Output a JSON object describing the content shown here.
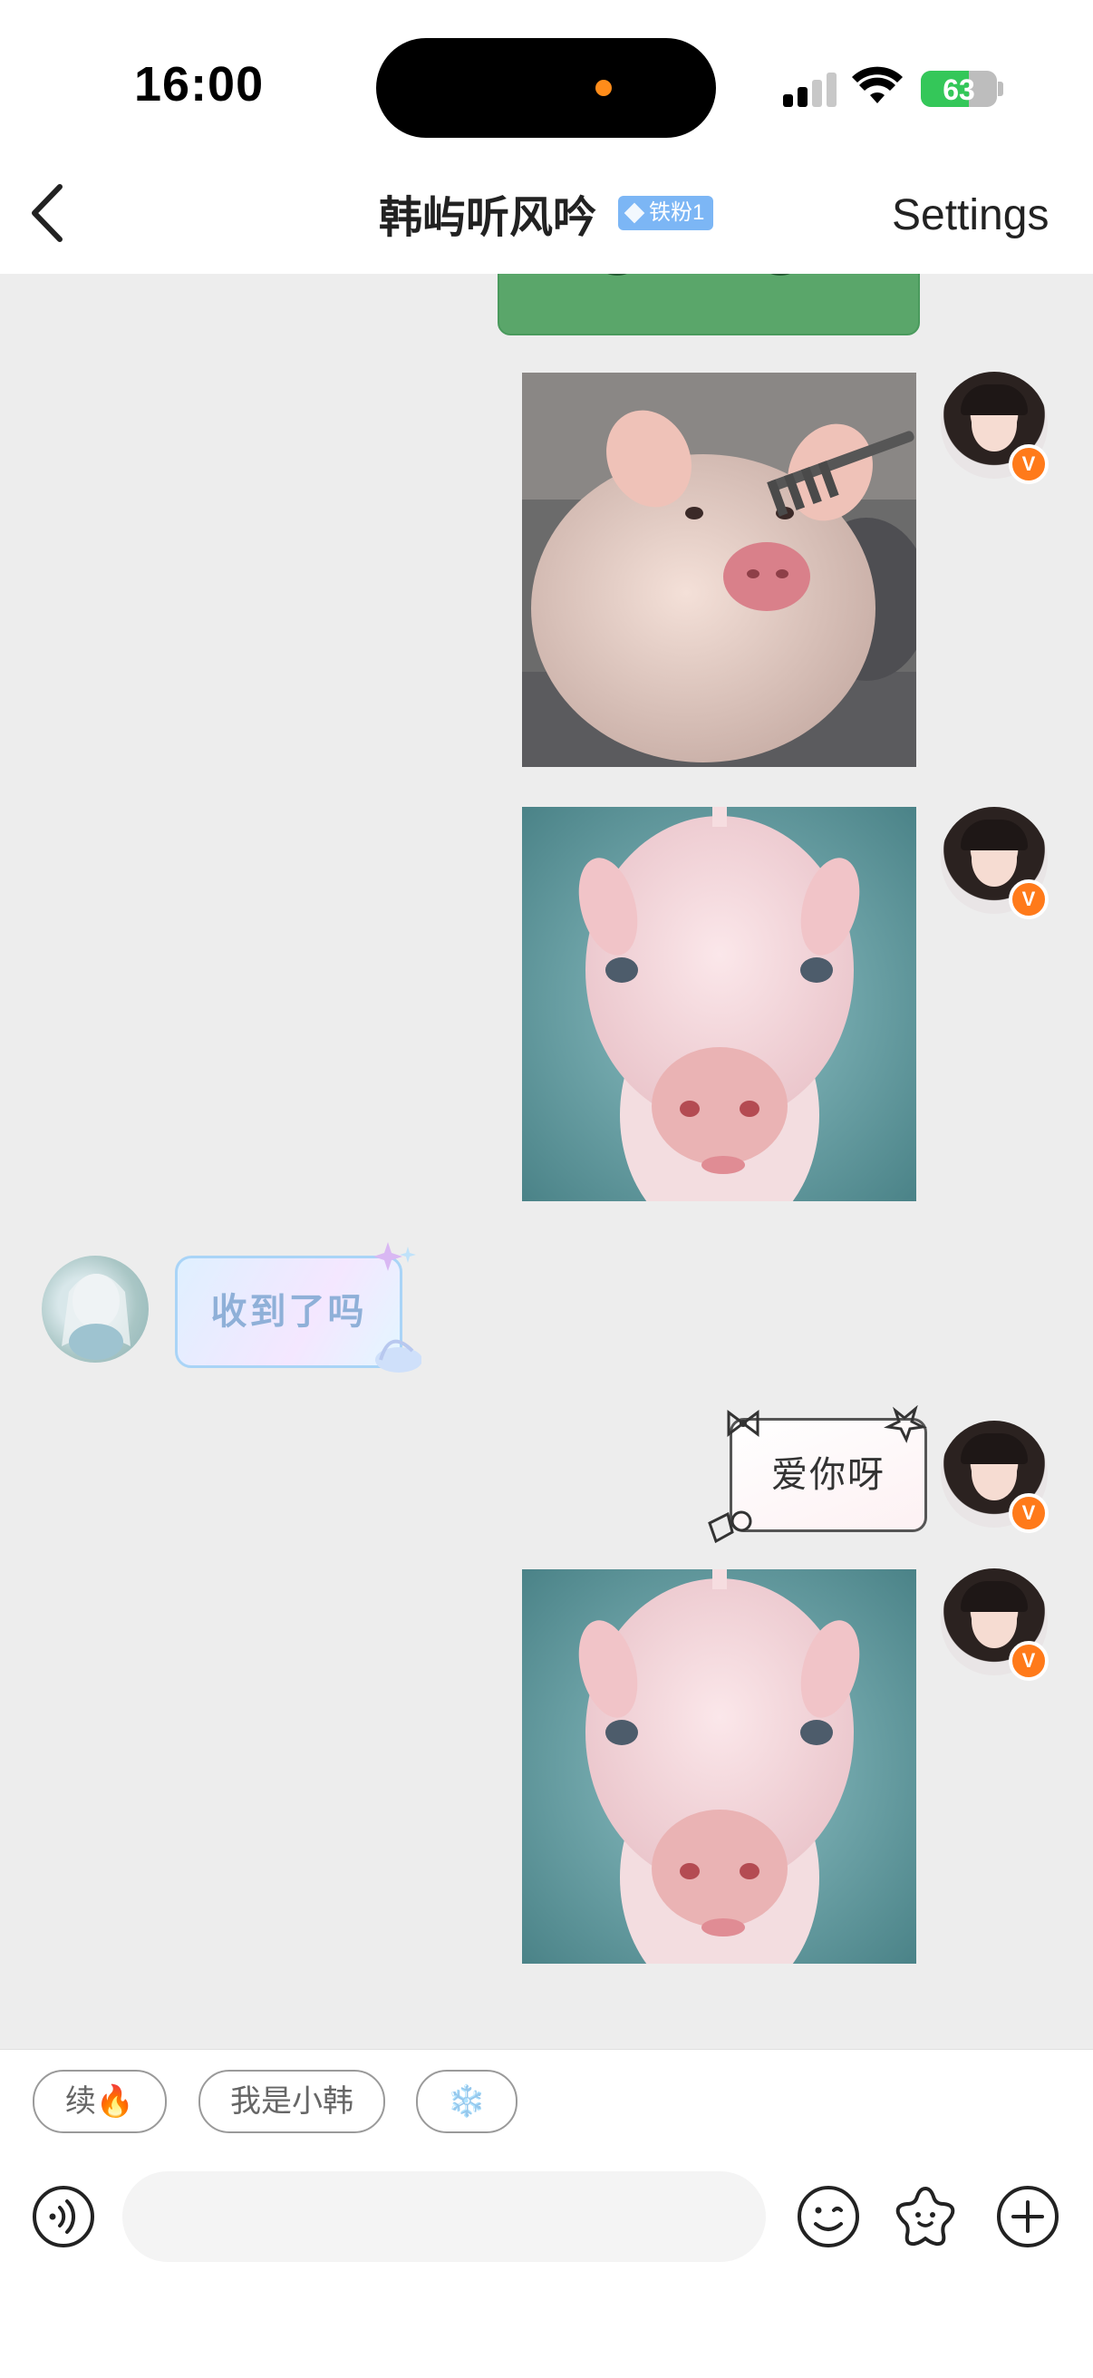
{
  "status_bar": {
    "time": "16:00",
    "battery": "63",
    "battery_level": 0.63
  },
  "header": {
    "back_icon": "chevron-left-icon",
    "title": "韩屿听风吟",
    "fan_badge": "铁粉1",
    "settings_label": "Settings"
  },
  "messages": [
    {
      "sender": "me",
      "type": "image",
      "content": "pig-being-brushed",
      "avatar_badge": "V"
    },
    {
      "sender": "me",
      "type": "image",
      "content": "pink-pig-portrait",
      "avatar_badge": "V"
    },
    {
      "sender": "them",
      "type": "text",
      "text": "收到了吗"
    },
    {
      "sender": "me",
      "type": "text",
      "text": "爱你呀",
      "avatar_badge": "V"
    },
    {
      "sender": "me",
      "type": "image",
      "content": "pink-pig-portrait",
      "avatar_badge": "V"
    }
  ],
  "quick_replies": [
    "续🔥",
    "我是小韩",
    "❄️"
  ],
  "composer": {
    "input_value": "",
    "icons": [
      "voice-icon",
      "emoji-icon",
      "sticker-icon",
      "plus-icon"
    ]
  },
  "colors": {
    "accent_orange": "#ff7a1a",
    "badge_blue": "#7cb6f5",
    "battery_green": "#34c759"
  }
}
